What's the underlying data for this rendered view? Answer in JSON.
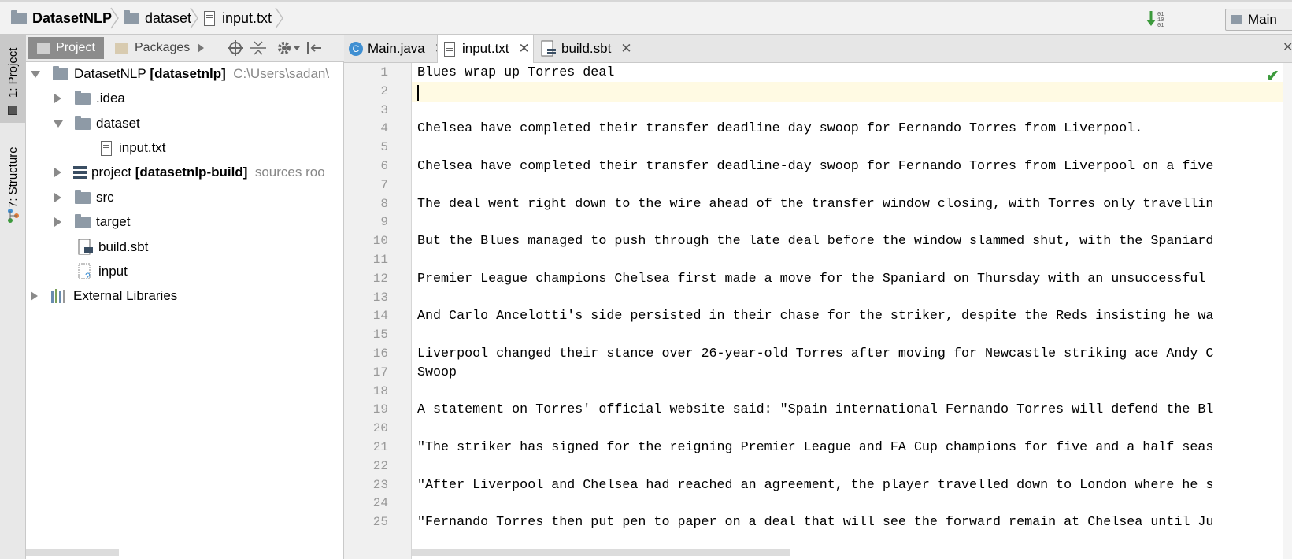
{
  "breadcrumb": {
    "project": "DatasetNLP",
    "folder": "dataset",
    "file": "input.txt"
  },
  "run_config": {
    "label": "Main"
  },
  "tool_strip": {
    "project_tab": "1: Project",
    "structure_tab": "7: Structure"
  },
  "project_panel": {
    "tabs": {
      "project": "Project",
      "packages": "Packages"
    },
    "tree": {
      "root_name": "DatasetNLP",
      "root_module": "[datasetnlp]",
      "root_path": "C:\\Users\\sadan\\",
      "idea": ".idea",
      "dataset": "dataset",
      "input_txt": "input.txt",
      "project_name": "project",
      "project_module": "[datasetnlp-build]",
      "project_suffix": "sources roo",
      "src": "src",
      "target": "target",
      "build_sbt": "build.sbt",
      "input": "input",
      "external_libraries": "External Libraries"
    }
  },
  "editor": {
    "tabs": [
      {
        "label": "Main.java",
        "icon": "java-class-icon"
      },
      {
        "label": "input.txt",
        "icon": "text-file-icon"
      },
      {
        "label": "build.sbt",
        "icon": "sbt-file-icon"
      }
    ],
    "line_numbers": [
      "1",
      "2",
      "3",
      "4",
      "5",
      "6",
      "7",
      "8",
      "9",
      "10",
      "11",
      "12",
      "13",
      "14",
      "15",
      "16",
      "17",
      "18",
      "19",
      "20",
      "21",
      "22",
      "23",
      "24",
      "25"
    ],
    "lines": [
      "Blues wrap up Torres deal",
      "",
      "",
      "Chelsea have completed their transfer deadline day swoop for Fernando Torres from Liverpool.",
      "",
      "Chelsea have completed their transfer deadline-day swoop for Fernando Torres from Liverpool on a five",
      "",
      "The deal went right down to the wire ahead of the transfer window closing, with Torres only travellin",
      "",
      "But the Blues managed to push through the late deal before the window slammed shut, with the Spaniard",
      "",
      "Premier League champions Chelsea first made a move for the Spaniard on Thursday with an unsuccessful",
      "",
      "And Carlo Ancelotti's side persisted in their chase for the striker, despite the Reds insisting he wa",
      "",
      "Liverpool changed their stance over 26-year-old Torres after moving for Newcastle striking ace Andy C",
      "Swoop",
      "",
      "A statement on Torres' official website said: \"Spain international Fernando Torres will defend the Bl",
      "",
      "\"The striker has signed for the reigning Premier League and FA Cup champions for five and a half seas",
      "",
      "\"After Liverpool and Chelsea had reached an agreement, the player travelled down to London where he s",
      "",
      "\"Fernando Torres then put pen to paper on a deal that will see the forward remain at Chelsea until Ju"
    ]
  },
  "colors": {
    "accent_java": "#3f8fd2",
    "check_green": "#3c9a3c",
    "current_line": "#fffae3"
  }
}
